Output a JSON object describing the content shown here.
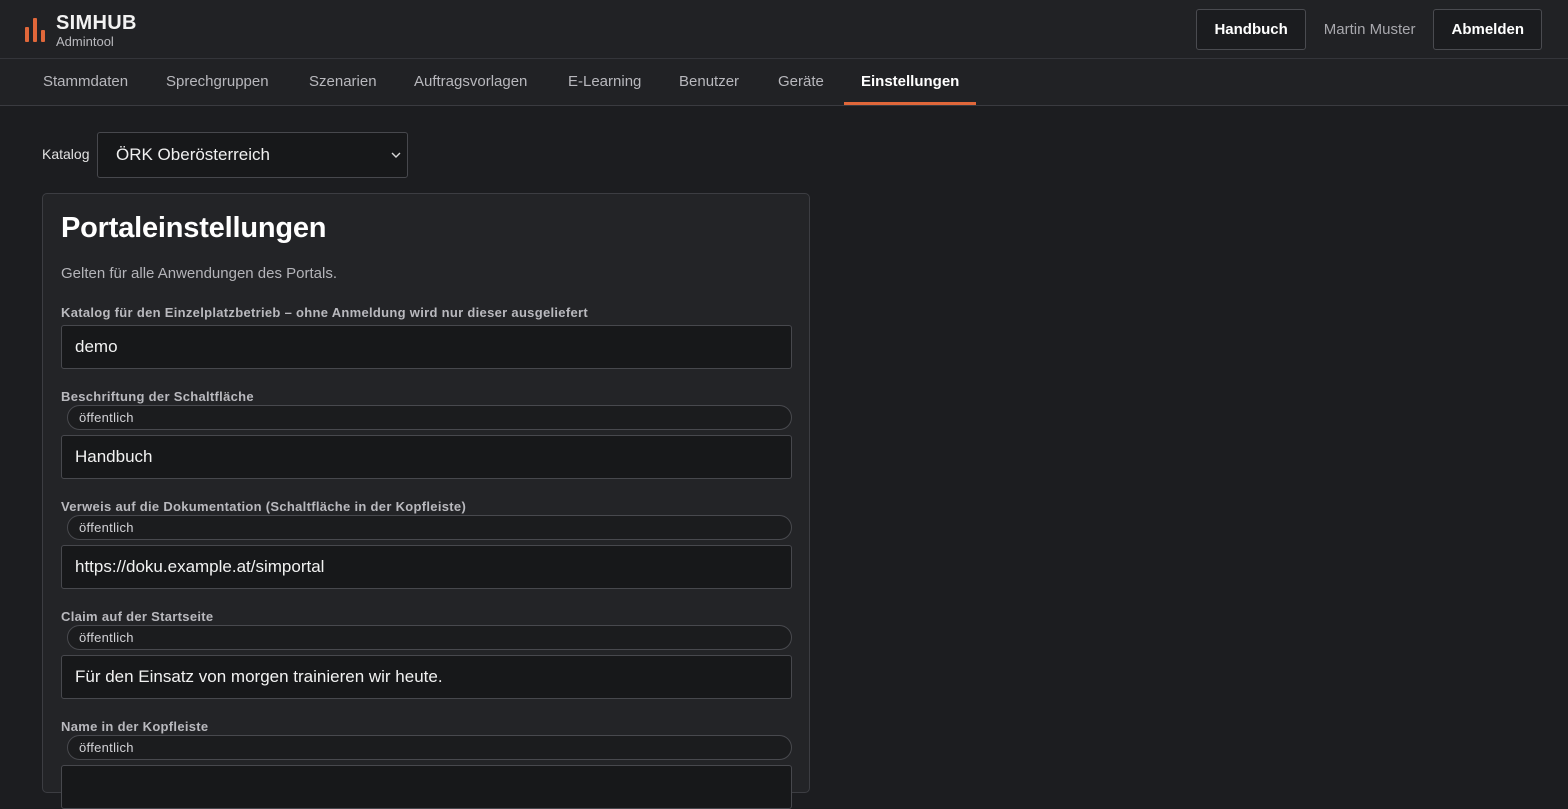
{
  "header": {
    "brand_name": "SIMHUB",
    "brand_sub": "Admintool",
    "manual_button": "Handbuch",
    "user_name": "Martin Muster",
    "logout_button": "Abmelden",
    "accent_color": "#e0673a"
  },
  "nav": {
    "items": [
      {
        "label": "Stammdaten"
      },
      {
        "label": "Sprechgruppen"
      },
      {
        "label": "Szenarien"
      },
      {
        "label": "Auftragsvorlagen"
      },
      {
        "label": "E-Learning"
      },
      {
        "label": "Benutzer"
      },
      {
        "label": "Geräte"
      },
      {
        "label": "Einstellungen"
      }
    ],
    "active": "Einstellungen"
  },
  "catalog": {
    "label": "Katalog",
    "selected": "ÖRK Oberösterreich"
  },
  "card": {
    "title": "Portaleinstellungen",
    "description": "Gelten für alle Anwendungen des Portals.",
    "fields": [
      {
        "label": "Katalog für den Einzelplatzbetrieb – ohne Anmeldung wird nur dieser ausgeliefert",
        "badge": "",
        "value": "demo"
      },
      {
        "label": "Beschriftung der Schaltfläche",
        "badge": "öffentlich",
        "value": "Handbuch"
      },
      {
        "label": "Verweis auf die Dokumentation (Schaltfläche in der Kopfleiste)",
        "badge": "öffentlich",
        "value": "https://doku.example.at/simportal"
      },
      {
        "label": "Claim auf der Startseite",
        "badge": "öffentlich",
        "value": "Für den Einsatz von morgen trainieren wir heute."
      },
      {
        "label": "Name in der Kopfleiste",
        "badge": "öffentlich",
        "value": ""
      }
    ]
  }
}
